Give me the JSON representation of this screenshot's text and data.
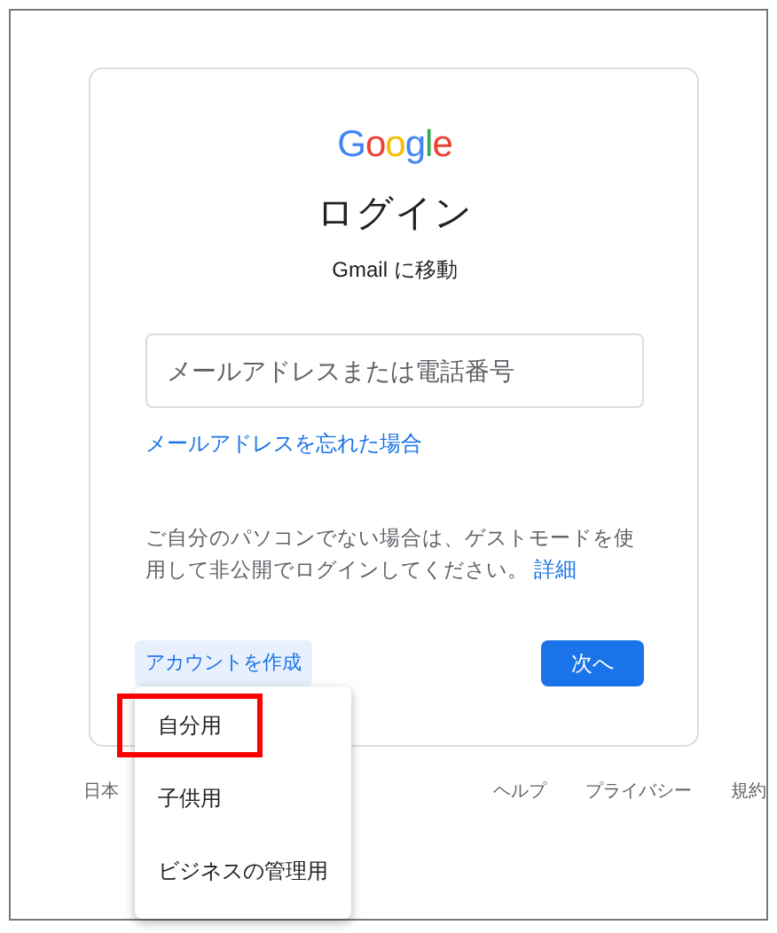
{
  "logo": "Google",
  "title": "ログイン",
  "subtitle": "Gmail に移動",
  "email_field": {
    "placeholder": "メールアドレスまたは電話番号"
  },
  "forgot_link": "メールアドレスを忘れた場合",
  "guest_note": "ご自分のパソコンでない場合は、ゲストモードを使用して非公開でログインしてください。",
  "guest_link": "詳細",
  "create_account": "アカウントを作成",
  "next_button": "次へ",
  "create_menu": [
    {
      "label": "自分用",
      "highlighted": true
    },
    {
      "label": "子供用",
      "highlighted": false
    },
    {
      "label": "ビジネスの管理用",
      "highlighted": false
    }
  ],
  "footer": {
    "language": "日本",
    "links": [
      "ヘルプ",
      "プライバシー",
      "規約"
    ]
  }
}
